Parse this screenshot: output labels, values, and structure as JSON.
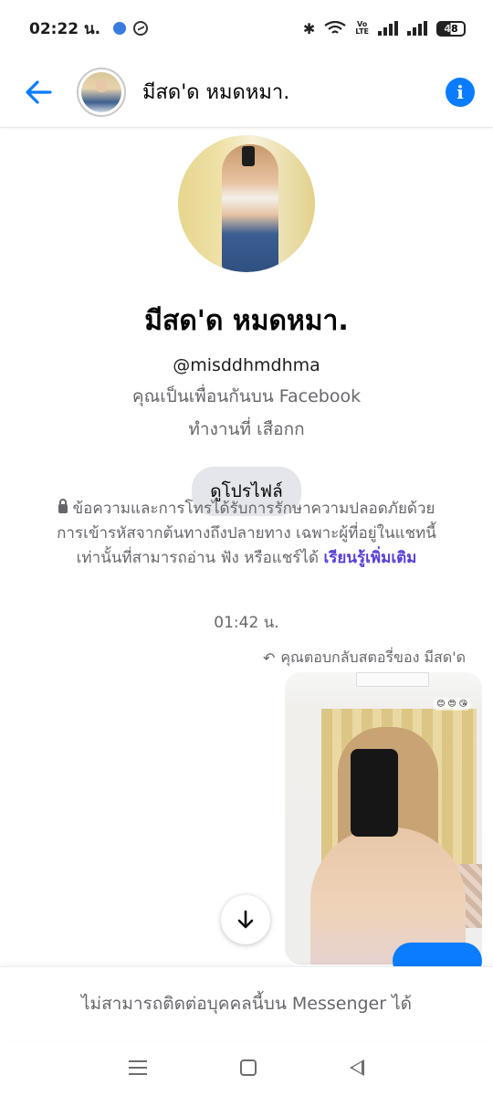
{
  "status_bar": {
    "time": "02:22 น.",
    "battery": "48"
  },
  "header": {
    "title": "มีสด'ด หมดหมา."
  },
  "profile": {
    "name": "มีสด'ด หมดหมา.",
    "handle": "@misddhmdhma",
    "friend_status": "คุณเป็นเพื่อนกันบน Facebook",
    "work": "ทำงานที่ เสือกก",
    "view_profile_label": "ดูโปรไฟล์"
  },
  "encryption": {
    "text": "ข้อความและการโทรได้รับการรักษาความปลอดภัยด้วยการเข้ารหัสจากต้นทางถึงปลายทาง เฉพาะผู้ที่อยู่ในแชทนี้เท่านั้นที่สามารถอ่าน ฟัง หรือแชร์ได้",
    "learn_more": "เรียนรู้เพิ่มเติม"
  },
  "conversation": {
    "timestamp": "01:42 น.",
    "story_reply": "คุณตอบกลับสตอรี่ของ มีสด'ด"
  },
  "footer": {
    "unavailable": "ไม่สามารถติดต่อบุคคลนี้บน Messenger ได้"
  },
  "colors": {
    "accent": "#0a7cff",
    "link": "#5b3fd6",
    "secondary_text": "#65676b"
  }
}
